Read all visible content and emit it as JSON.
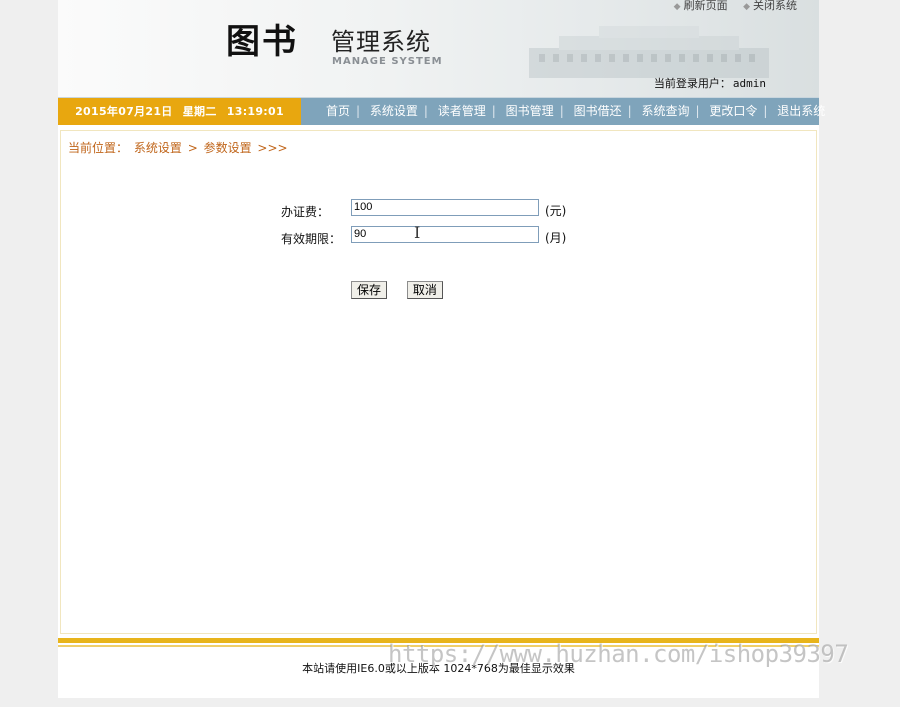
{
  "header": {
    "logo_main": "图书",
    "logo_sub": "管理系统",
    "logo_en": "MANAGE SYSTEM",
    "top_links": {
      "refresh": "刷新页面",
      "close": "关闭系统"
    },
    "user_label": "当前登录用户：",
    "user_name": "admin"
  },
  "navbar": {
    "date": "2015年07月21日",
    "weekday": "星期二",
    "time": "13:19:01",
    "menu": [
      "首页",
      "系统设置",
      "读者管理",
      "图书管理",
      "图书借还",
      "系统查询",
      "更改口令",
      "退出系统"
    ]
  },
  "breadcrumb": {
    "prefix": "当前位置：",
    "level1": "系统设置",
    "arrow": ">",
    "level2": "参数设置",
    "suffix": ">>>"
  },
  "form": {
    "fee_label": "办证费：",
    "fee_value": "100",
    "fee_unit": "(元)",
    "period_label": "有效期限：",
    "period_value": "90",
    "period_unit": "(月)",
    "save_label": "保存",
    "cancel_label": "取消"
  },
  "footer": {
    "text": "本站请使用IE6.0或以上版本 1024*768为最佳显示效果"
  },
  "watermark": "https://www.huzhan.com/ishop39397",
  "colors": {
    "navbar": "#7fa4bb",
    "datebox": "#e8a70f",
    "breadcrumb": "#c0651a",
    "footer_line": "#e8b41a"
  }
}
